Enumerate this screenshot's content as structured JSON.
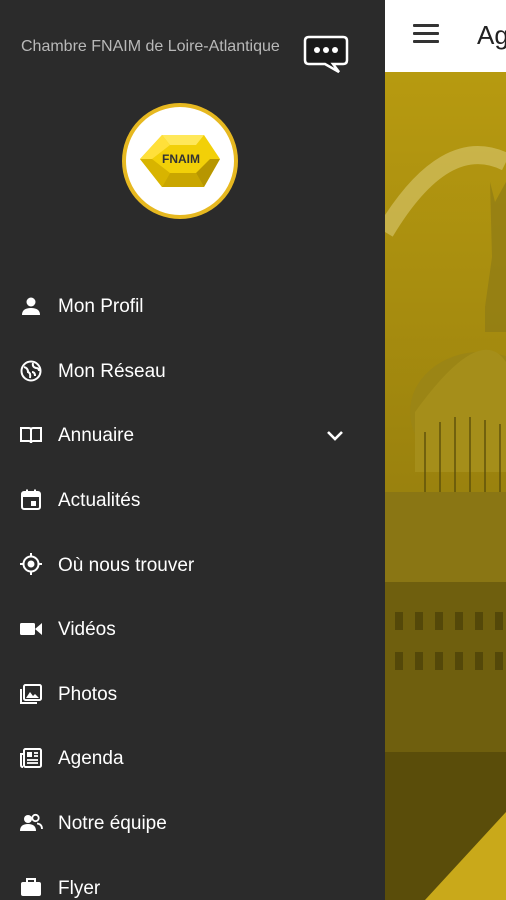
{
  "app": {
    "header_title": "Ag",
    "colors": {
      "drawer_bg": "#2b2b2b",
      "accent": "#e6b820",
      "header_bg": "#ffffff"
    }
  },
  "drawer": {
    "brand_title": "Chambre FNAIM de Loire-Atlantique",
    "logo_text": "FNAIM",
    "chat_icon": "chat-bubble-icon",
    "menu": [
      {
        "id": "mon-profil",
        "label": "Mon Profil",
        "icon": "person-icon"
      },
      {
        "id": "mon-reseau",
        "label": "Mon Réseau",
        "icon": "globe-icon"
      },
      {
        "id": "annuaire",
        "label": "Annuaire",
        "icon": "book-icon",
        "expandable": true
      },
      {
        "id": "actualites",
        "label": "Actualités",
        "icon": "calendar-icon"
      },
      {
        "id": "ou-nous-trouver",
        "label": "Où nous trouver",
        "icon": "location-icon"
      },
      {
        "id": "videos",
        "label": "Vidéos",
        "icon": "video-camera-icon"
      },
      {
        "id": "photos",
        "label": "Photos",
        "icon": "photos-icon"
      },
      {
        "id": "agenda",
        "label": "Agenda",
        "icon": "newspaper-icon"
      },
      {
        "id": "notre-equipe",
        "label": "Notre équipe",
        "icon": "team-icon"
      },
      {
        "id": "flyer",
        "label": "Flyer",
        "icon": "briefcase-icon"
      }
    ]
  }
}
